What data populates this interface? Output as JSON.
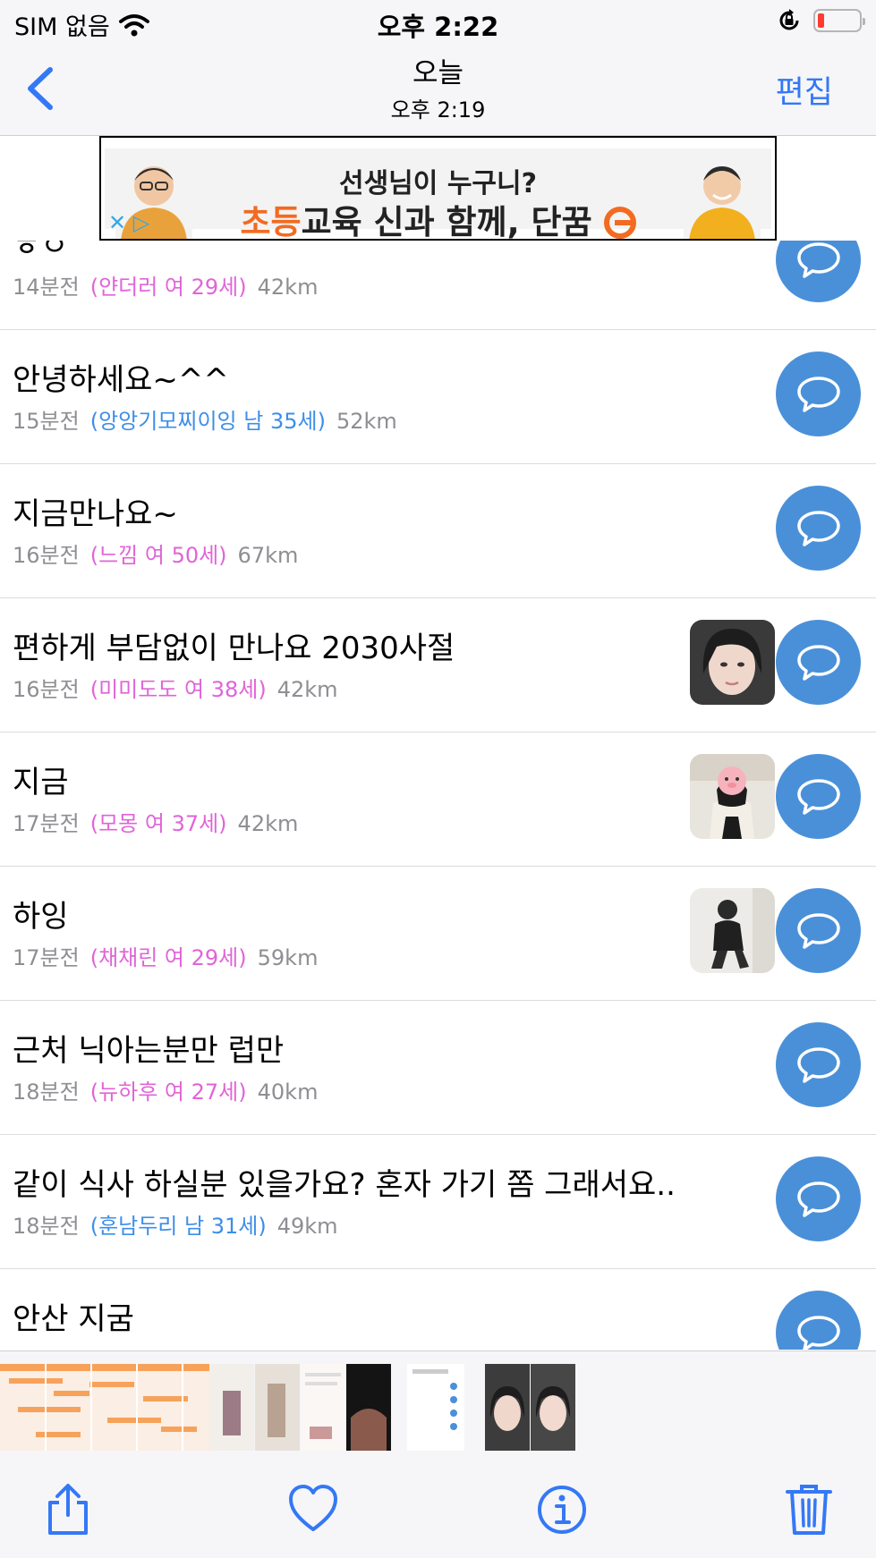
{
  "status": {
    "carrier": "SIM 없음",
    "time": "오후 2:22"
  },
  "nav": {
    "title": "오늘",
    "subtitle": "오후 2:19",
    "edit_label": "편집"
  },
  "ad": {
    "line1": "선생님이 누구니?",
    "line2_orange": "초등",
    "line2_mid": "교육 신과 함께, ",
    "line2_bold": "단꿈",
    "close_glyph": "✕ ▷"
  },
  "posts": [
    {
      "title": "ㅎㅇ",
      "time": "14분전",
      "user": "(얀더러 여 29세)",
      "gender": "female",
      "distance": "42km",
      "has_photo": false
    },
    {
      "title": "안녕하세요~^^",
      "time": "15분전",
      "user": "(앙앙기모찌이잉 남 35세)",
      "gender": "male",
      "distance": "52km",
      "has_photo": false
    },
    {
      "title": "지금만나요~",
      "time": "16분전",
      "user": "(느낌 여 50세)",
      "gender": "female",
      "distance": "67km",
      "has_photo": false
    },
    {
      "title": "편하게 부담없이 만나요 2030사절",
      "time": "16분전",
      "user": "(미미도도 여 38세)",
      "gender": "female",
      "distance": "42km",
      "has_photo": true
    },
    {
      "title": "지금",
      "time": "17분전",
      "user": "(모몽 여 37세)",
      "gender": "female",
      "distance": "42km",
      "has_photo": true
    },
    {
      "title": "하잉",
      "time": "17분전",
      "user": "(채채린 여 29세)",
      "gender": "female",
      "distance": "59km",
      "has_photo": true
    },
    {
      "title": "근처 닉아는분만 럽만",
      "time": "18분전",
      "user": "(뉴하후 여 27세)",
      "gender": "female",
      "distance": "40km",
      "has_photo": false
    },
    {
      "title": "같이 식사 하실분 있을가요? 혼자 가기 쫌 그래서요..",
      "time": "18분전",
      "user": "(훈남두리 남 31세)",
      "gender": "male",
      "distance": "49km",
      "has_photo": false
    },
    {
      "title": "안산 지굼",
      "time": "",
      "user": "",
      "gender": "",
      "distance": "",
      "has_photo": false
    }
  ],
  "colors": {
    "accent": "#3478f6",
    "chat_button": "#4a90d9",
    "female": "#e064d8",
    "male": "#3d8ee8",
    "meta_gray": "#8e8e93",
    "bar_bg": "#f6f6f8"
  },
  "icons": {
    "back": "chevron-left-icon",
    "chat": "speech-bubble-icon",
    "share": "share-icon",
    "favorite": "heart-icon",
    "info": "info-icon",
    "delete": "trash-icon"
  }
}
